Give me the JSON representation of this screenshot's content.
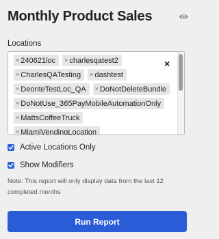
{
  "header": {
    "title": "Monthly Product Sales",
    "visibility_icon": "eye-icon"
  },
  "locations": {
    "label": "Locations",
    "remove_glyph": "×",
    "clear_all_glyph": "×",
    "selected": [
      "240621loc",
      "charlesqatest2",
      "CharlesQATesting",
      "dashtest",
      "DeonteTestLoc_QA",
      "DoNotDeleteBundle",
      "DoNotUse_365PayMobileAutomationOnly",
      "MattsCoffeeTruck",
      "MiamiVendingLocation"
    ]
  },
  "options": {
    "active_locations_only": {
      "label": "Active Locations Only",
      "checked": true
    },
    "show_modifiers": {
      "label": "Show Modifiers",
      "checked": true
    }
  },
  "note": "Note: This report will only display data from the last 12 completed months",
  "actions": {
    "run_report_label": "Run Report"
  },
  "colors": {
    "accent": "#2b5cd8",
    "checkbox": "#2a62d8",
    "background": "#efefef"
  }
}
